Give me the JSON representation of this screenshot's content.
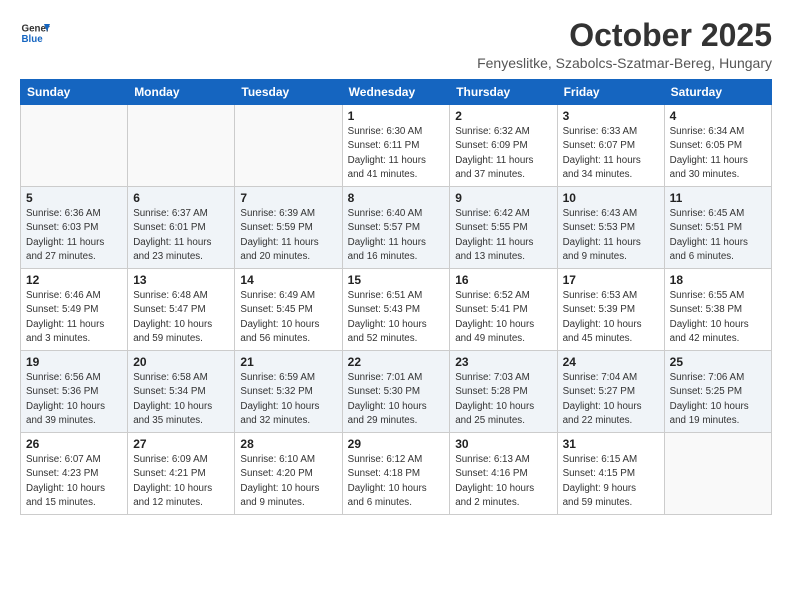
{
  "logo": {
    "line1": "General",
    "line2": "Blue"
  },
  "title": "October 2025",
  "subtitle": "Fenyeslitke, Szabolcs-Szatmar-Bereg, Hungary",
  "days_header": [
    "Sunday",
    "Monday",
    "Tuesday",
    "Wednesday",
    "Thursday",
    "Friday",
    "Saturday"
  ],
  "weeks": [
    [
      {
        "day": "",
        "info": ""
      },
      {
        "day": "",
        "info": ""
      },
      {
        "day": "",
        "info": ""
      },
      {
        "day": "1",
        "info": "Sunrise: 6:30 AM\nSunset: 6:11 PM\nDaylight: 11 hours\nand 41 minutes."
      },
      {
        "day": "2",
        "info": "Sunrise: 6:32 AM\nSunset: 6:09 PM\nDaylight: 11 hours\nand 37 minutes."
      },
      {
        "day": "3",
        "info": "Sunrise: 6:33 AM\nSunset: 6:07 PM\nDaylight: 11 hours\nand 34 minutes."
      },
      {
        "day": "4",
        "info": "Sunrise: 6:34 AM\nSunset: 6:05 PM\nDaylight: 11 hours\nand 30 minutes."
      }
    ],
    [
      {
        "day": "5",
        "info": "Sunrise: 6:36 AM\nSunset: 6:03 PM\nDaylight: 11 hours\nand 27 minutes."
      },
      {
        "day": "6",
        "info": "Sunrise: 6:37 AM\nSunset: 6:01 PM\nDaylight: 11 hours\nand 23 minutes."
      },
      {
        "day": "7",
        "info": "Sunrise: 6:39 AM\nSunset: 5:59 PM\nDaylight: 11 hours\nand 20 minutes."
      },
      {
        "day": "8",
        "info": "Sunrise: 6:40 AM\nSunset: 5:57 PM\nDaylight: 11 hours\nand 16 minutes."
      },
      {
        "day": "9",
        "info": "Sunrise: 6:42 AM\nSunset: 5:55 PM\nDaylight: 11 hours\nand 13 minutes."
      },
      {
        "day": "10",
        "info": "Sunrise: 6:43 AM\nSunset: 5:53 PM\nDaylight: 11 hours\nand 9 minutes."
      },
      {
        "day": "11",
        "info": "Sunrise: 6:45 AM\nSunset: 5:51 PM\nDaylight: 11 hours\nand 6 minutes."
      }
    ],
    [
      {
        "day": "12",
        "info": "Sunrise: 6:46 AM\nSunset: 5:49 PM\nDaylight: 11 hours\nand 3 minutes."
      },
      {
        "day": "13",
        "info": "Sunrise: 6:48 AM\nSunset: 5:47 PM\nDaylight: 10 hours\nand 59 minutes."
      },
      {
        "day": "14",
        "info": "Sunrise: 6:49 AM\nSunset: 5:45 PM\nDaylight: 10 hours\nand 56 minutes."
      },
      {
        "day": "15",
        "info": "Sunrise: 6:51 AM\nSunset: 5:43 PM\nDaylight: 10 hours\nand 52 minutes."
      },
      {
        "day": "16",
        "info": "Sunrise: 6:52 AM\nSunset: 5:41 PM\nDaylight: 10 hours\nand 49 minutes."
      },
      {
        "day": "17",
        "info": "Sunrise: 6:53 AM\nSunset: 5:39 PM\nDaylight: 10 hours\nand 45 minutes."
      },
      {
        "day": "18",
        "info": "Sunrise: 6:55 AM\nSunset: 5:38 PM\nDaylight: 10 hours\nand 42 minutes."
      }
    ],
    [
      {
        "day": "19",
        "info": "Sunrise: 6:56 AM\nSunset: 5:36 PM\nDaylight: 10 hours\nand 39 minutes."
      },
      {
        "day": "20",
        "info": "Sunrise: 6:58 AM\nSunset: 5:34 PM\nDaylight: 10 hours\nand 35 minutes."
      },
      {
        "day": "21",
        "info": "Sunrise: 6:59 AM\nSunset: 5:32 PM\nDaylight: 10 hours\nand 32 minutes."
      },
      {
        "day": "22",
        "info": "Sunrise: 7:01 AM\nSunset: 5:30 PM\nDaylight: 10 hours\nand 29 minutes."
      },
      {
        "day": "23",
        "info": "Sunrise: 7:03 AM\nSunset: 5:28 PM\nDaylight: 10 hours\nand 25 minutes."
      },
      {
        "day": "24",
        "info": "Sunrise: 7:04 AM\nSunset: 5:27 PM\nDaylight: 10 hours\nand 22 minutes."
      },
      {
        "day": "25",
        "info": "Sunrise: 7:06 AM\nSunset: 5:25 PM\nDaylight: 10 hours\nand 19 minutes."
      }
    ],
    [
      {
        "day": "26",
        "info": "Sunrise: 6:07 AM\nSunset: 4:23 PM\nDaylight: 10 hours\nand 15 minutes."
      },
      {
        "day": "27",
        "info": "Sunrise: 6:09 AM\nSunset: 4:21 PM\nDaylight: 10 hours\nand 12 minutes."
      },
      {
        "day": "28",
        "info": "Sunrise: 6:10 AM\nSunset: 4:20 PM\nDaylight: 10 hours\nand 9 minutes."
      },
      {
        "day": "29",
        "info": "Sunrise: 6:12 AM\nSunset: 4:18 PM\nDaylight: 10 hours\nand 6 minutes."
      },
      {
        "day": "30",
        "info": "Sunrise: 6:13 AM\nSunset: 4:16 PM\nDaylight: 10 hours\nand 2 minutes."
      },
      {
        "day": "31",
        "info": "Sunrise: 6:15 AM\nSunset: 4:15 PM\nDaylight: 9 hours\nand 59 minutes."
      },
      {
        "day": "",
        "info": ""
      }
    ]
  ]
}
